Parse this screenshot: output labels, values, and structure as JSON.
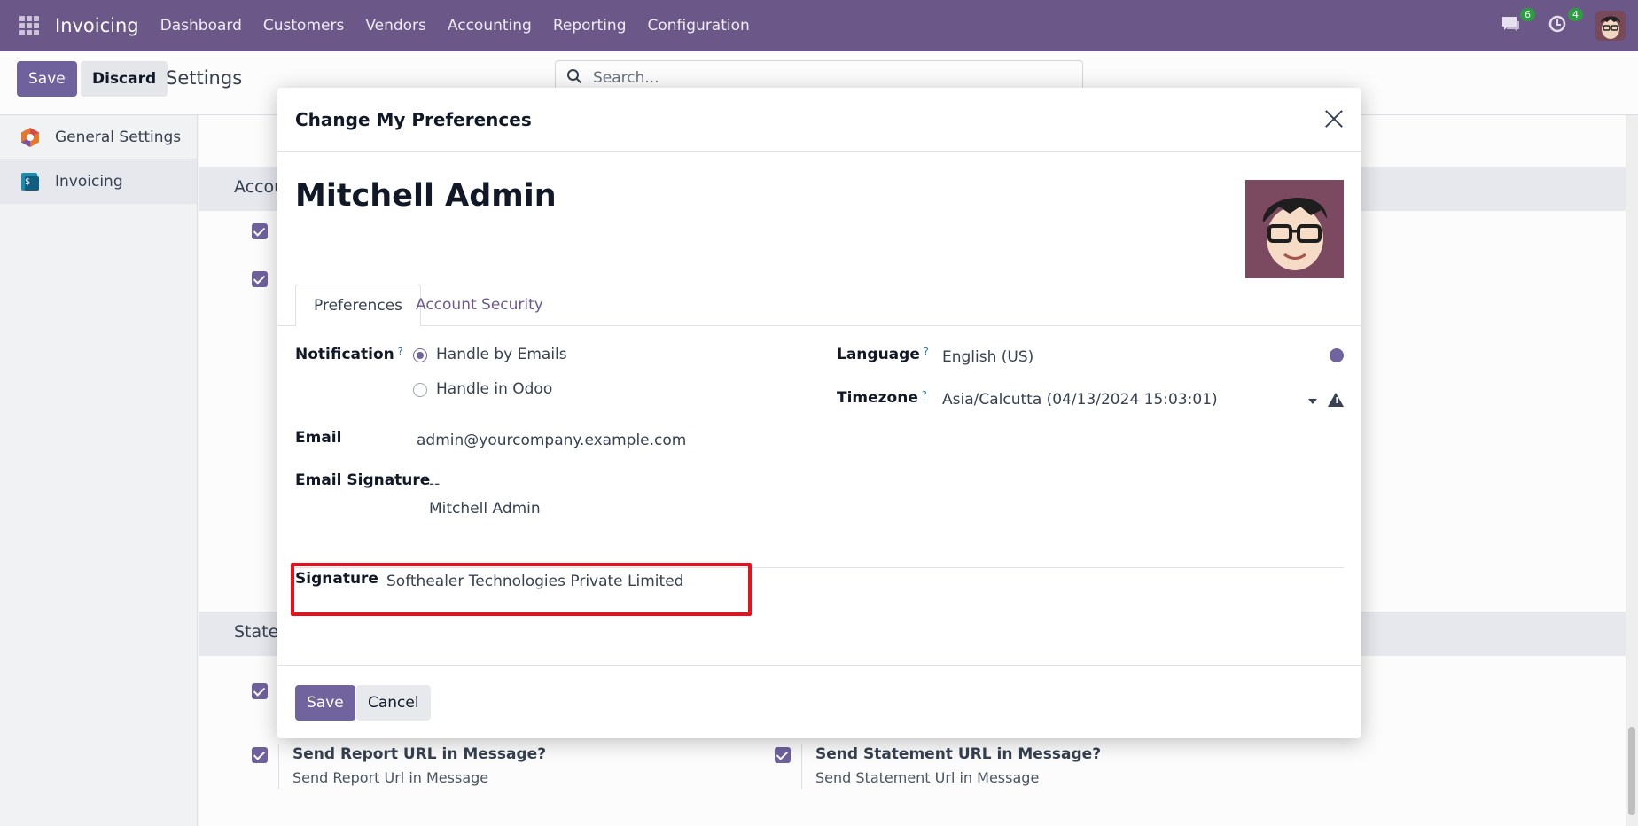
{
  "topnav": {
    "app_name": "Invoicing",
    "menu": [
      "Dashboard",
      "Customers",
      "Vendors",
      "Accounting",
      "Reporting",
      "Configuration"
    ],
    "chat_count": "6",
    "activity_count": "4",
    "brand_color": "#6e5a8a"
  },
  "control_panel": {
    "save_label": "Save",
    "discard_label": "Discard",
    "title": "Settings",
    "search_placeholder": "Search..."
  },
  "sidebar": {
    "items": [
      {
        "label": "General Settings",
        "icon": "settings-icon"
      },
      {
        "label": "Invoicing",
        "icon": "invoicing-icon"
      }
    ]
  },
  "background": {
    "section1": "Accou",
    "section2": "Stater",
    "settings": [
      {
        "title": "Send Report URL in Message?",
        "desc": "Send Report Url in Message"
      },
      {
        "title": "Send Statement URL in Message?",
        "desc": "Send Statement Url in Message"
      }
    ]
  },
  "modal": {
    "title": "Change My Preferences",
    "user_name": "Mitchell Admin",
    "tabs": [
      "Preferences",
      "Account Security"
    ],
    "notification": {
      "label": "Notification",
      "help": "?",
      "options": [
        {
          "label": "Handle by Emails",
          "checked": true
        },
        {
          "label": "Handle in Odoo",
          "checked": false
        }
      ]
    },
    "email": {
      "label": "Email",
      "value": "admin@yourcompany.example.com"
    },
    "email_signature": {
      "label": "Email Signature",
      "line1": "--",
      "line2": "Mitchell Admin"
    },
    "language": {
      "label": "Language",
      "help": "?",
      "value": "English (US)"
    },
    "timezone": {
      "label": "Timezone",
      "help": "?",
      "value": "Asia/Calcutta (04/13/2024 15:03:01)"
    },
    "signature": {
      "label": "Signature",
      "value": "Softhealer Technologies Private Limited"
    },
    "save_label": "Save",
    "cancel_label": "Cancel"
  },
  "colors": {
    "primary": "#71639e",
    "highlight": "#e8101a"
  }
}
